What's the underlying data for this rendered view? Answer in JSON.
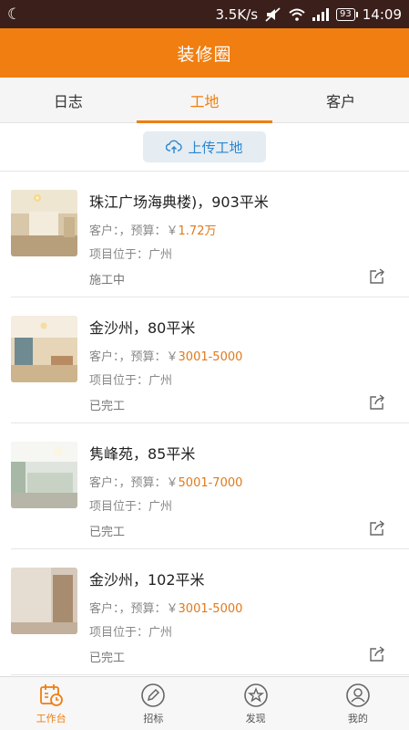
{
  "statusbar": {
    "speed": "3.5K/s",
    "battery": "93",
    "time": "14:09"
  },
  "header": {
    "title": "装修圈"
  },
  "tabs": [
    {
      "label": "日志",
      "active": false
    },
    {
      "label": "工地",
      "active": true
    },
    {
      "label": "客户",
      "active": false
    }
  ],
  "upload": {
    "label": "上传工地"
  },
  "sites": [
    {
      "title": "珠江广场海典楼)，903平米",
      "client_label": "客户：，预算：",
      "currency": "￥",
      "budget": "1.72万",
      "location": "项目位于：广州",
      "status": "施工中"
    },
    {
      "title": "金沙州，80平米",
      "client_label": "客户：，预算：",
      "currency": "￥",
      "budget": "3001-5000",
      "location": "项目位于：广州",
      "status": "已完工"
    },
    {
      "title": "隽峰苑，85平米",
      "client_label": "客户：，预算：",
      "currency": "￥",
      "budget": "5001-7000",
      "location": "项目位于：广州",
      "status": "已完工"
    },
    {
      "title": "金沙州，102平米",
      "client_label": "客户：，预算：",
      "currency": "￥",
      "budget": "3001-5000",
      "location": "项目位于：广州",
      "status": "已完工"
    }
  ],
  "bottomnav": [
    {
      "label": "工作台",
      "icon": "calendar-clock-icon",
      "active": true
    },
    {
      "label": "招标",
      "icon": "pencil-icon",
      "active": false
    },
    {
      "label": "发现",
      "icon": "star-icon",
      "active": false
    },
    {
      "label": "我的",
      "icon": "user-icon",
      "active": false
    }
  ],
  "colors": {
    "accent": "#f07e10",
    "statusbar": "#3a1f1a",
    "link": "#2a86d0",
    "price": "#e07a1c"
  }
}
